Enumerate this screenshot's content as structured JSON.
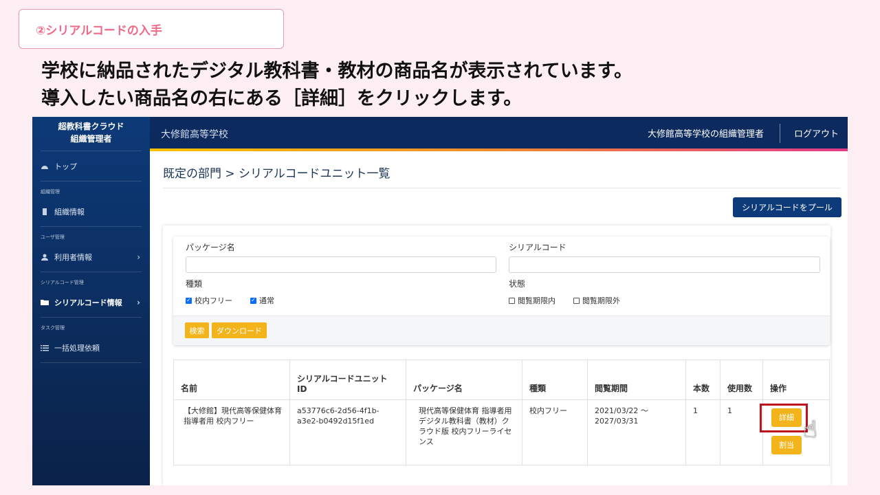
{
  "step_badge": "②シリアルコードの入手",
  "instructions": {
    "line1": "学校に納品されたデジタル教科書・教材の商品名が表示されています。",
    "line2": "導入したい商品名の右にある［詳細］をクリックします。"
  },
  "sidebar": {
    "title_line1": "超教科書クラウド",
    "title_line2": "組織管理者",
    "top_label": "トップ",
    "sections": [
      {
        "heading": "組織管理",
        "item": "組織情報"
      },
      {
        "heading": "ユーザ管理",
        "item": "利用者情報"
      },
      {
        "heading": "シリアルコード管理",
        "item": "シリアルコード情報"
      },
      {
        "heading": "タスク管理",
        "item": "一括処理依頼"
      }
    ]
  },
  "topbar": {
    "school": "大修館高等学校",
    "admin": "大修館高等学校の組織管理者",
    "logout": "ログアウト"
  },
  "breadcrumb": "既定の部門 > シリアルコードユニット一覧",
  "pull_button": "シリアルコードをプール",
  "filter": {
    "package_label": "パッケージ名",
    "package_value": "",
    "serial_label": "シリアルコード",
    "serial_value": "",
    "type_label": "種類",
    "type_options": [
      "校内フリー",
      "通常"
    ],
    "status_label": "状態",
    "status_options": [
      "閲覧期限内",
      "閲覧期限外"
    ],
    "search_button": "検索",
    "download_button": "ダウンロード"
  },
  "table": {
    "headers": [
      "名前",
      "シリアルコードユニット ID",
      "パッケージ名",
      "種類",
      "閲覧期間",
      "本数",
      "使用数",
      "操作"
    ],
    "rows": [
      {
        "name": "【大修館】現代高等保健体育 指導者用 校内フリー",
        "unit_id": "a53776c6-2d56-4f1b-a3e2-b0492d15f1ed",
        "package": "現代高等保健体育 指導者用デジタル教科書（教材）クラウド版 校内フリーライセンス",
        "type": "校内フリー",
        "period": "2021/03/22 ～ 2027/03/31",
        "count": "1",
        "used": "1",
        "detail_button": "詳細",
        "assign_button": "割当"
      }
    ]
  },
  "colors": {
    "navy": "#0d2a5e",
    "accent_yellow": "#f3b31a",
    "highlight_red": "#c0121e",
    "badge_pink": "#f06a88"
  }
}
